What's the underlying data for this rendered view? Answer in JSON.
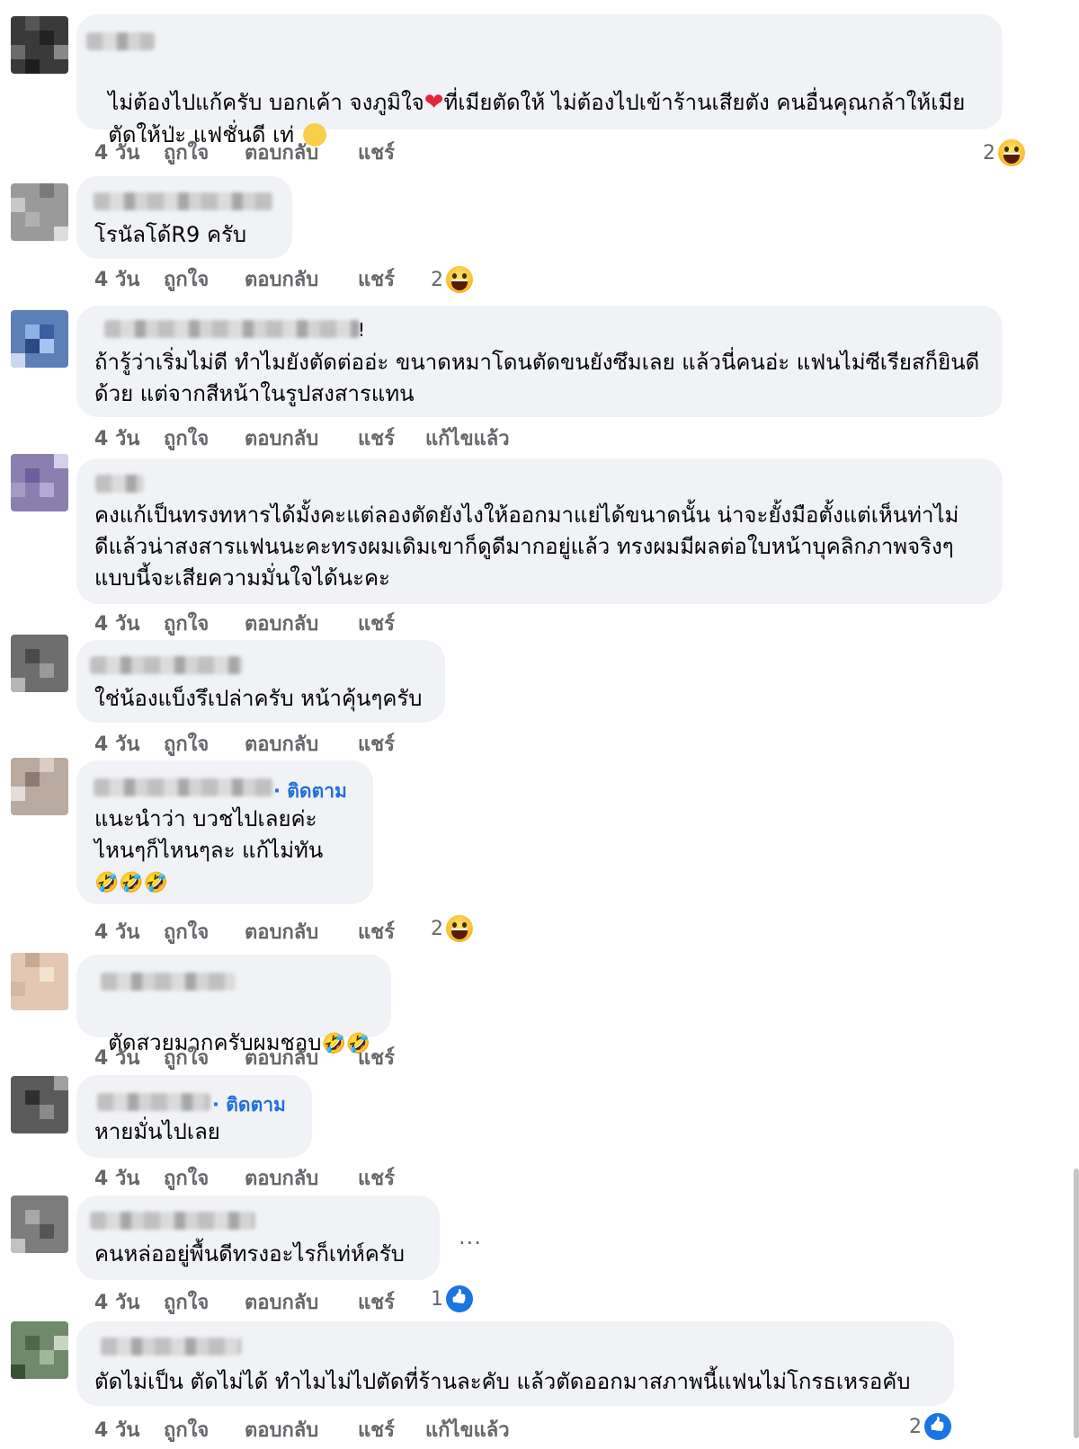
{
  "comments": [
    {
      "text": "ไม่ต้องไปแก้ครับ บอกเค้า จงภูมิใจ",
      "text_after_heart": "ที่เมียตัดให้ ไม่ต้องไปเข้าร้านเสียตัง คนอื่นคุณกล้าให้เมีย",
      "text_line2": "ตัดให้ป่ะ แฟชั่นดี เท่",
      "time": "4 วัน",
      "like": "ถูกใจ",
      "reply": "ตอบกลับ",
      "share": "แชร์",
      "reaction_count": "2",
      "reaction_icon": "haha-icon"
    },
    {
      "text": "โรนัลโด้R9 ครับ",
      "time": "4 วัน",
      "like": "ถูกใจ",
      "reply": "ตอบกลับ",
      "share": "แชร์",
      "reaction_count": "2",
      "reaction_icon": "haha-icon"
    },
    {
      "name_suffix": "!",
      "text": "ถ้ารู้ว่าเริ่มไม่ดี ทำไมยังตัดต่ออ่ะ ขนาดหมาโดนตัดขนยังซึมเลย แล้วนี่คนอ่ะ แฟนไม่ซีเรียสก็ยินดี\nด้วย แต่จากสีหน้าในรูปสงสารแทน",
      "time": "4 วัน",
      "like": "ถูกใจ",
      "reply": "ตอบกลับ",
      "share": "แชร์",
      "edited": "แก้ไขแล้ว"
    },
    {
      "text": "คงแก้เป็นทรงทหารได้มั้งคะแต่ลองตัดยังไงให้ออกมาแย่ได้ขนาดนั้น น่าจะยั้งมือตั้งแต่เห็นท่าไม่\nดีแล้วน่าสงสารแฟนนะคะทรงผมเดิมเขาก็ดูดีมากอยู่แล้ว ทรงผมมีผลต่อใบหน้าบุคลิกภาพจริงๆ\nแบบนี้จะเสียความมั่นใจได้นะคะ",
      "time": "4 วัน",
      "like": "ถูกใจ",
      "reply": "ตอบกลับ",
      "share": "แชร์"
    },
    {
      "text": "ใช่น้องแบ็งรึเปล่าครับ หน้าคุ้นๆครับ",
      "time": "4 วัน",
      "like": "ถูกใจ",
      "reply": "ตอบกลับ",
      "share": "แชร์"
    },
    {
      "follow": "· ติดตาม",
      "text": "แนะนำว่า บวชไปเลยค่ะ\nไหนๆก็ไหนๆละ แก้ไม่ทัน",
      "emojis": "🤣🤣🤣",
      "time": "4 วัน",
      "like": "ถูกใจ",
      "reply": "ตอบกลับ",
      "share": "แชร์",
      "reaction_count": "2",
      "reaction_icon": "haha-icon"
    },
    {
      "text": "ตัดสวยมากครับผมชอบ",
      "emojis": "🤣🤣",
      "time": "4 วัน",
      "like": "ถูกใจ",
      "reply": "ตอบกลับ",
      "share": "แชร์"
    },
    {
      "follow": "· ติดตาม",
      "text": "หายมั่นไปเลย",
      "time": "4 วัน",
      "like": "ถูกใจ",
      "reply": "ตอบกลับ",
      "share": "แชร์"
    },
    {
      "text": "คนหล่ออยู่พื้นดีทรงอะไรก็เท่ห์ครับ",
      "more": "...",
      "time": "4 วัน",
      "like": "ถูกใจ",
      "reply": "ตอบกลับ",
      "share": "แชร์",
      "reaction_count": "1",
      "reaction_icon": "like-icon"
    },
    {
      "text": "ตัดไม่เป็น ตัดไม่ได้ ทำไมไม่ไปตัดที่ร้านละคับ แล้วตัดออกมาสภาพนี้แฟนไม่โกรธเหรอคับ",
      "time": "4 วัน",
      "like": "ถูกใจ",
      "reply": "ตอบกลับ",
      "share": "แชร์",
      "edited": "แก้ไขแล้ว",
      "reaction_count": "2",
      "reaction_icon": "like-icon"
    }
  ],
  "colors": {
    "bubble": "#f0f2f5",
    "meta": "#65676b",
    "link": "#216fdb"
  }
}
